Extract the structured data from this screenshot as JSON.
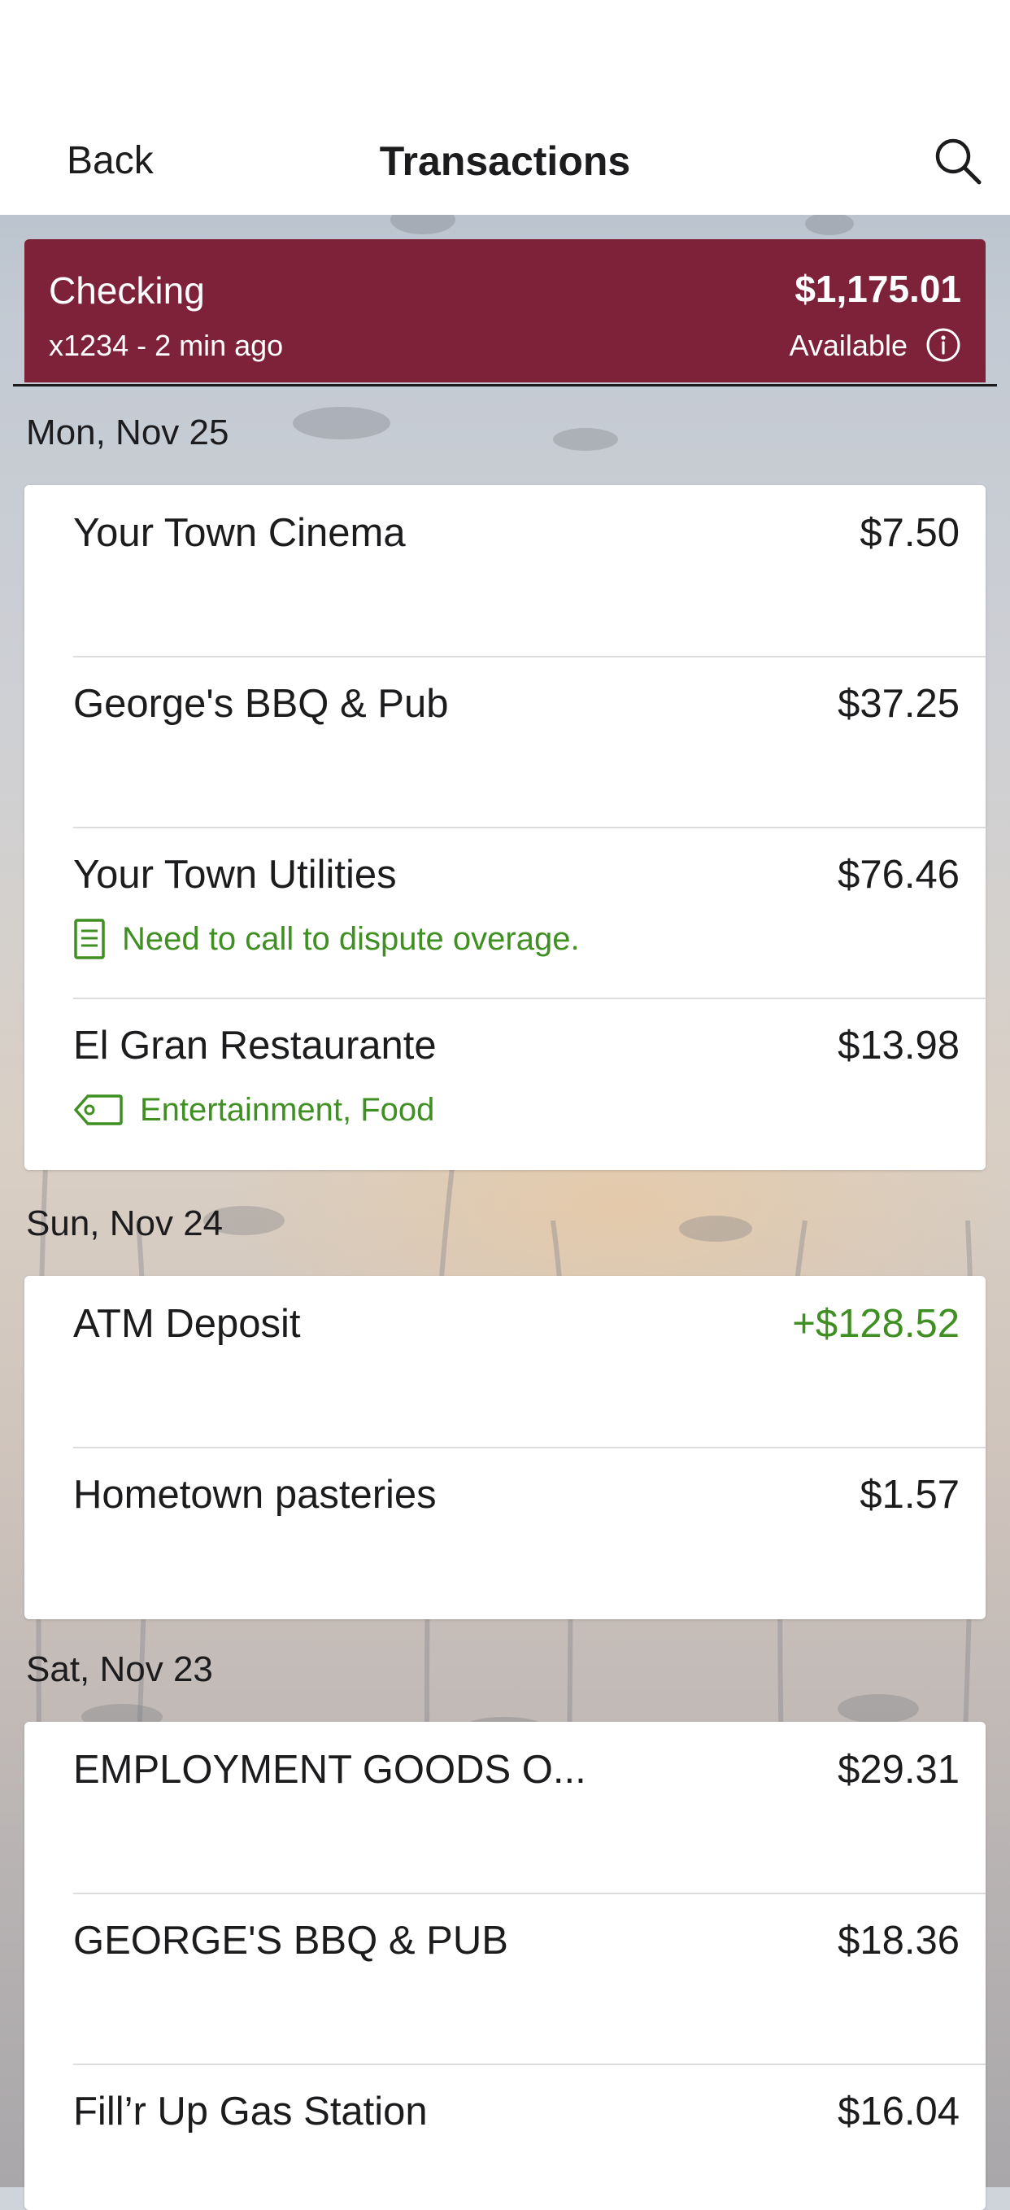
{
  "nav": {
    "back_label": "Back",
    "title": "Transactions",
    "search_icon": "search-icon"
  },
  "account": {
    "name": "Checking",
    "subtitle": "x1234 - 2 min ago",
    "balance": "$1,175.01",
    "balance_label": "Available",
    "info_icon": "info-icon",
    "color": "#7d2238"
  },
  "colors": {
    "credit": "#3f8f22",
    "meta": "#3f8f22"
  },
  "groups": [
    {
      "date": "Mon, Nov 25",
      "items": [
        {
          "name": "Your Town Cinema",
          "amount": "$7.50"
        },
        {
          "name": "George's BBQ & Pub",
          "amount": "$37.25"
        },
        {
          "name": "Your Town Utilities",
          "amount": "$76.46",
          "note": "Need to call to dispute overage.",
          "note_icon": "note-icon"
        },
        {
          "name": "El Gran Restaurante",
          "amount": "$13.98",
          "tags": "Entertainment, Food",
          "tags_icon": "tag-icon"
        }
      ]
    },
    {
      "date": "Sun, Nov 24",
      "items": [
        {
          "name": "ATM Deposit",
          "amount": "+$128.52",
          "credit": true
        },
        {
          "name": "Hometown pasteries",
          "amount": "$1.57"
        }
      ]
    },
    {
      "date": "Sat, Nov 23",
      "items": [
        {
          "name": "EMPLOYMENT GOODS O...",
          "amount": "$29.31"
        },
        {
          "name": "GEORGE'S BBQ & PUB",
          "amount": "$18.36"
        },
        {
          "name": "Fill’r Up Gas Station",
          "amount": "$16.04"
        }
      ]
    }
  ]
}
